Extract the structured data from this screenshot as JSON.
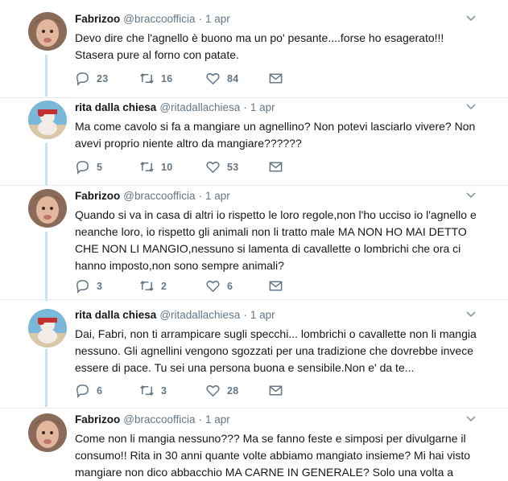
{
  "tweets": [
    {
      "author": "Fabrizoo",
      "handle": "@braccoofficia",
      "dot": "·",
      "time": "1 apr",
      "text": "Devo dire che l'agnello è buono ma un po' pesante....forse ho esagerato!!! Stasera pure al forno con patate.",
      "replies": "23",
      "retweets": "16",
      "likes": "84",
      "avatar": "fabrizoo"
    },
    {
      "author": "rita dalla chiesa",
      "handle": "@ritadallachiesa",
      "dot": "·",
      "time": "1 apr",
      "text": "Ma come cavolo si fa a mangiare un agnellino? Non potevi lasciarlo vivere? Non avevi proprio niente altro da mangiare??????",
      "replies": "5",
      "retweets": "10",
      "likes": "53",
      "avatar": "rita"
    },
    {
      "author": "Fabrizoo",
      "handle": "@braccoofficia",
      "dot": "·",
      "time": "1 apr",
      "text": "Quando si va in casa di altri io rispetto le loro regole,non l'ho ucciso io l'agnello e neanche loro, io rispetto gli animali non li tratto male MA NON HO MAI DETTO CHE NON LI MANGIO,nessuno si lamenta di cavallette o lombrichi che ora ci hanno imposto,non sono sempre animali?",
      "replies": "3",
      "retweets": "2",
      "likes": "6",
      "avatar": "fabrizoo"
    },
    {
      "author": "rita dalla chiesa",
      "handle": "@ritadallachiesa",
      "dot": "·",
      "time": "1 apr",
      "text": "Dai, Fabri, non ti arrampicare sugli specchi... lombrichi o cavallette non li mangia nessuno. Gli agnellini vengono sgozzati per una tradizione che dovrebbe invece essere di pace. Tu sei una persona buona e sensibile.Non e' da te...",
      "replies": "6",
      "retweets": "3",
      "likes": "28",
      "avatar": "rita"
    },
    {
      "author": "Fabrizoo",
      "handle": "@braccoofficia",
      "dot": "·",
      "time": "1 apr",
      "text": "Come non li mangia nessuno??? Ma se fanno feste e simposi per divulgarne il consumo!! Rita in 30 anni quante volte abbiamo mangiato insieme? Mi hai visto mangiare non dico abbacchio MA CARNE IN GENERALE? Solo una volta a",
      "avatar": "fabrizoo"
    }
  ],
  "colors": {
    "thread_line": "#c4e3f8",
    "meta": "#657786",
    "text": "#14171a",
    "separator": "#e6ecf0"
  },
  "icons": {
    "reply": "reply-icon",
    "retweet": "retweet-icon",
    "like": "heart-icon",
    "dm": "envelope-icon",
    "caret": "chevron-down-icon"
  }
}
